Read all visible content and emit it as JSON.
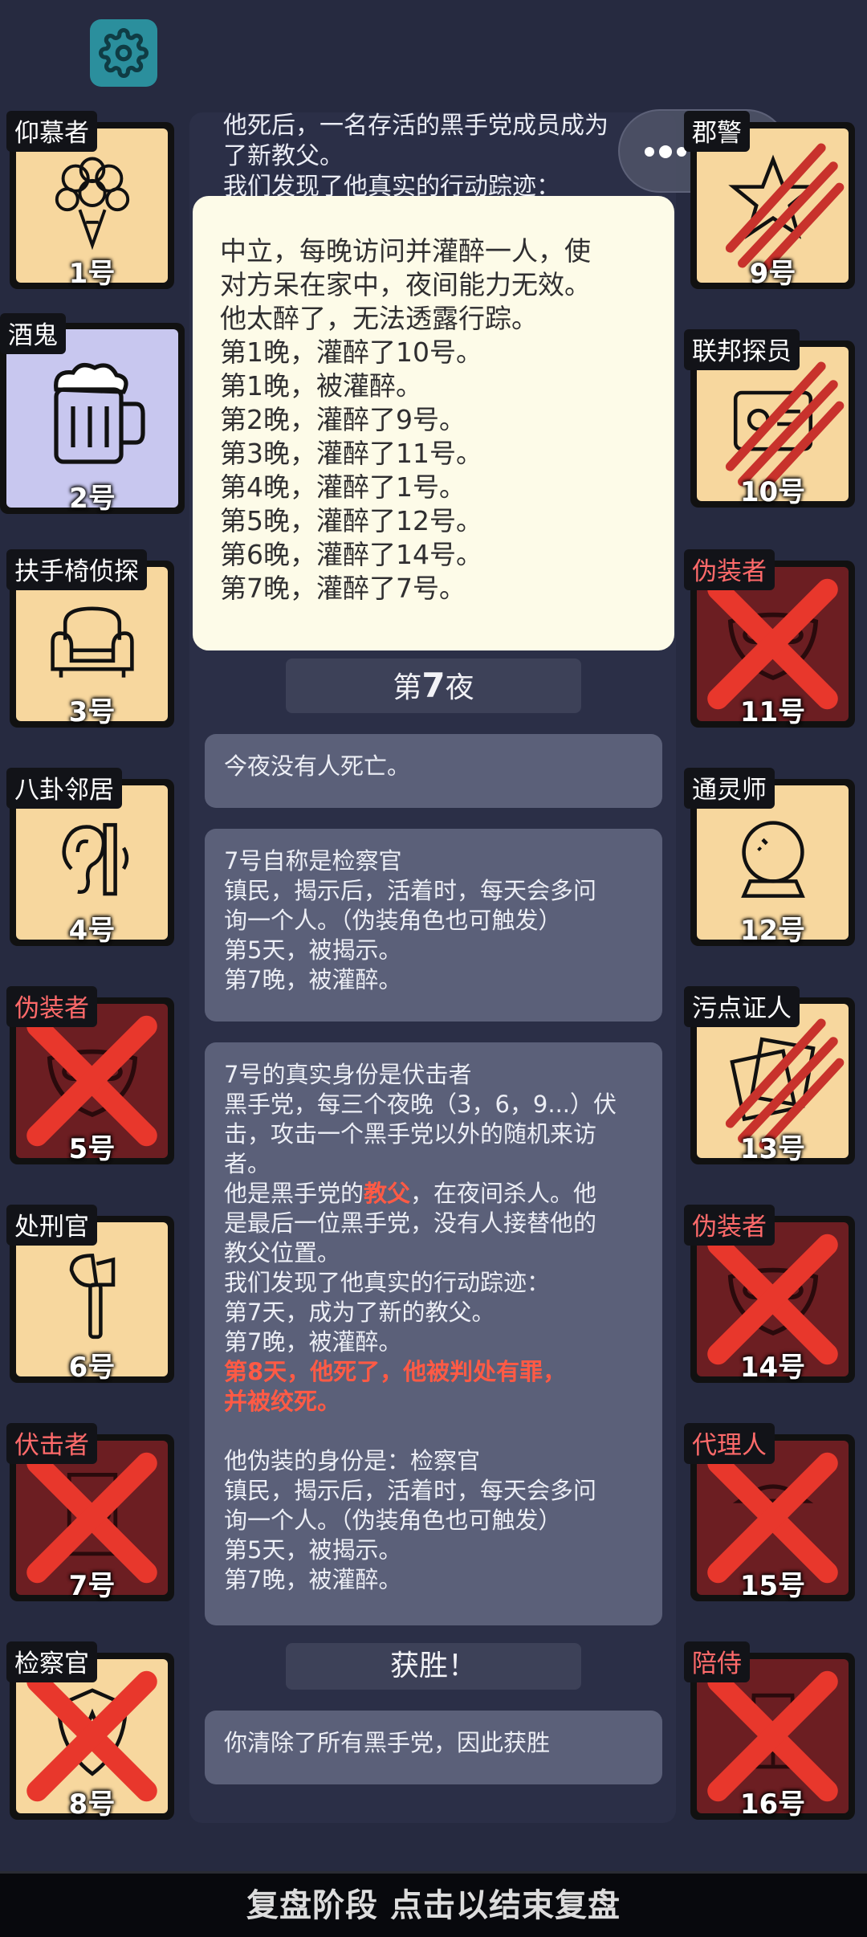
{
  "settings": {
    "icon": "gear-icon",
    "accent": "#2b8f9d"
  },
  "left_column": [
    {
      "label": "仰慕者",
      "number": "1号",
      "icon": "flower-bouquet-icon",
      "dead": false,
      "label_red": false
    },
    {
      "label": "酒鬼",
      "number": "2号",
      "icon": "beer-mug-icon",
      "dead": false,
      "label_red": false,
      "highlight": true
    },
    {
      "label": "扶手椅侦探",
      "number": "3号",
      "icon": "armchair-icon",
      "dead": false,
      "label_red": false
    },
    {
      "label": "八卦邻居",
      "number": "4号",
      "icon": "ear-icon",
      "dead": false,
      "label_red": false
    },
    {
      "label": "伪装者",
      "number": "5号",
      "icon": "mask-icon",
      "dead": true,
      "label_red": true
    },
    {
      "label": "处刑官",
      "number": "6号",
      "icon": "axe-icon",
      "dead": false,
      "label_red": false
    },
    {
      "label": "伏击者",
      "number": "7号",
      "icon": "door-icon",
      "dead": true,
      "label_red": true
    },
    {
      "label": "检察官",
      "number": "8号",
      "icon": "badge-icon",
      "dead": true,
      "label_red": false
    }
  ],
  "right_column": [
    {
      "label": "郡警",
      "number": "9号",
      "icon": "sheriff-star-icon",
      "dead": false,
      "claw": true
    },
    {
      "label": "联邦探员",
      "number": "10号",
      "icon": "id-card-icon",
      "dead": false,
      "claw": true
    },
    {
      "label": "伪装者",
      "number": "11号",
      "icon": "mask-icon",
      "dead": true,
      "label_red": true
    },
    {
      "label": "通灵师",
      "number": "12号",
      "icon": "crystal-ball-icon",
      "dead": false
    },
    {
      "label": "污点证人",
      "number": "13号",
      "icon": "documents-icon",
      "dead": false,
      "claw": true
    },
    {
      "label": "伪装者",
      "number": "14号",
      "icon": "mask-icon",
      "dead": true,
      "label_red": true
    },
    {
      "label": "代理人",
      "number": "15号",
      "icon": "spy-icon",
      "dead": true,
      "label_red": true
    },
    {
      "label": "陪侍",
      "number": "16号",
      "icon": "wine-glass-icon",
      "dead": true,
      "label_red": true
    }
  ],
  "log_top": {
    "line1": "他死后，一名存活的黑手党成员成为",
    "line2": "了新教父。",
    "line3": "我们发现了他真实的行动踪迹："
  },
  "popup": {
    "lines": [
      "中立，每晚访问并灌醉一人，使",
      "对方呆在家中，夜间能力无效。",
      "他太醉了，无法透露行踪。",
      "第1晚，灌醉了10号。",
      "第1晚，被灌醉。",
      "第2晚，灌醉了9号。",
      "第3晚，灌醉了11号。",
      "第4晚，灌醉了1号。",
      "第5晚，灌醉了12号。",
      "第6晚，灌醉了14号。",
      "第7晚，灌醉了7号。"
    ]
  },
  "night7": {
    "prefix": "第",
    "num": "7",
    "suffix": "夜"
  },
  "log": {
    "no_death": "今夜没有人死亡。",
    "claim": [
      "7号自称是检察官",
      "镇民，揭示后，活着时，每天会多问",
      "询一个人。（伪装角色也可触发）",
      "第5天，被揭示。",
      "第7晚，被灌醉。"
    ],
    "reveal_head": [
      "7号的真实身份是伏击者",
      "黑手党，每三个夜晚（3，6，9...）伏",
      "击，攻击一个黑手党以外的随机来访",
      "者。"
    ],
    "godfather_pre": "他是黑手党的",
    "godfather_word": "教父",
    "godfather_post": "，在夜间杀人。他",
    "reveal_mid": [
      "是最后一位黑手党，没有人接替他的",
      "教父位置。",
      "我们发现了他真实的行动踪迹：",
      "第7天，成为了新的教父。",
      "第7晚，被灌醉。"
    ],
    "death_line1": "第8天，他死了，他被判处有罪，",
    "death_line2": "并被绞死。",
    "disguise": [
      "他伪装的身份是：检察官",
      "镇民，揭示后，活着时，每天会多问",
      "询一个人。（伪装角色也可触发）",
      "第5天，被揭示。",
      "第7晚，被灌醉。"
    ],
    "victory_head": "获胜！",
    "victory_text": "你清除了所有黑手党，因此获胜"
  },
  "bottom_bar": {
    "label": "复盘阶段 点击以结束复盘"
  },
  "colors": {
    "background": "#262a40",
    "card": "#f7d79e",
    "dead_card": "#6c1e22",
    "red_x": "#e8372c",
    "highlight_text": "#ff5a45"
  }
}
